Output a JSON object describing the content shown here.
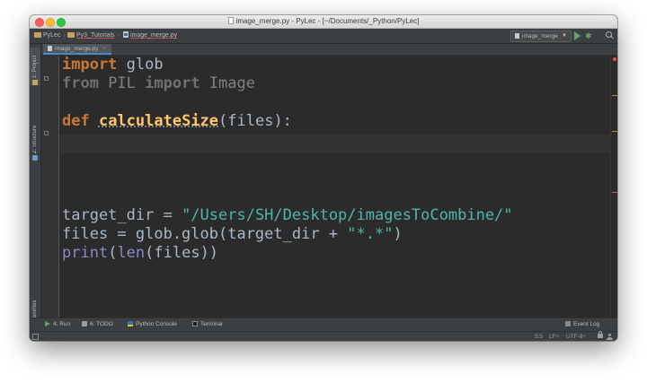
{
  "window": {
    "title": "image_merge.py - PyLec - [~/Documents/_Python/PyLec]"
  },
  "navbar": {
    "breadcrumbs": [
      "PyLec",
      "Py3_Tutorials",
      "image_merge.py"
    ],
    "run_config": "image_merge"
  },
  "left_tools": {
    "project": "1: Project",
    "structure": "Z: Structure",
    "favorites": "2: Favorites"
  },
  "editor_tabs": [
    {
      "label": "image_merge.py",
      "active": true
    }
  ],
  "code": {
    "line1": {
      "kw": "import",
      "rest": " glob"
    },
    "line2": {
      "kw1": "from",
      "mod": " PIL ",
      "kw2": "import",
      "name": " Image"
    },
    "line3": {
      "kw": "def",
      "fn": "calculateSize",
      "params": "(files):"
    },
    "line4": {
      "var": "target_dir = ",
      "str": "\"/Users/SH/Desktop/imagesToCombine/\""
    },
    "line5": {
      "pre": "files = glob.glob(target_dir + ",
      "q1": "\"",
      "pattern": "*.*",
      "q2": "\"",
      "post": ")"
    },
    "line6": {
      "bi1": "print",
      "p1": "(",
      "bi2": "len",
      "p2": "(files))"
    }
  },
  "tool_windows": {
    "run": "4: Run",
    "todo": "6: TODO",
    "python_console": "Python Console",
    "terminal": "Terminal",
    "event_log": "Event Log"
  },
  "status": {
    "position": "5:5",
    "line_sep": "LF÷",
    "encoding": "UTF-8÷"
  },
  "colors": {
    "keyword": "#cc7832",
    "function": "#ffc66d",
    "string": "#6a8759",
    "builtin": "#8888c6",
    "background": "#2b2b2b"
  }
}
